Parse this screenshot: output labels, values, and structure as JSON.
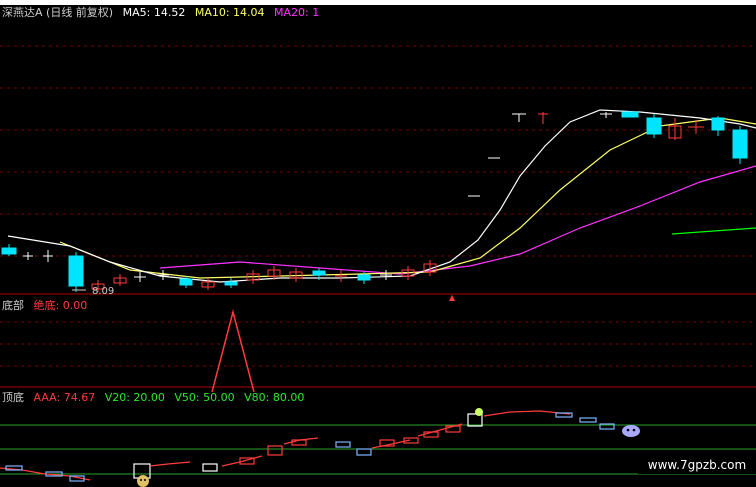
{
  "colors": {
    "up": "#ff3b3b",
    "down": "#00e5ff",
    "doji": "#ffffff",
    "ma5": "#ffffff",
    "ma10": "#ffff66",
    "ma20": "#ff33ff",
    "ma60": "#00ff00",
    "grid": "#7a0000",
    "axis": "#b00000",
    "line_green": "#2aa52a"
  },
  "main_panel": {
    "title": "深燕达A (日线 前复权)",
    "ma5_label": "MA5: 14.52",
    "ma10_label": "MA10: 14.04",
    "ma20_label": "MA20: 1",
    "low_annotation": "8.09"
  },
  "bottom_panel": {
    "title": "底部",
    "value_label": "绝底: 0.00"
  },
  "top_panel": {
    "title": "顶底",
    "aaa_label": "AAA: 74.67",
    "v20_label": "V20: 20.00",
    "v50_label": "V50: 50.00",
    "v80_label": "V80: 80.00"
  },
  "watermark": "www.7gpzb.com"
}
